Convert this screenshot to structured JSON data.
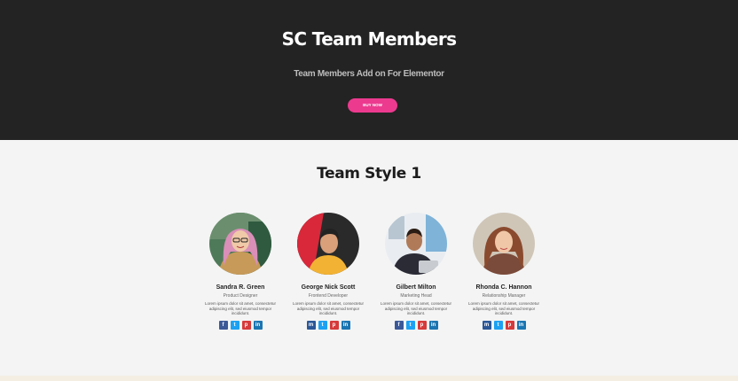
{
  "hero": {
    "title": "SC Team Members",
    "subtitle": "Team Members Add on For Elementor",
    "button_label": "Buy Now",
    "accent": "#ec3a8f",
    "background": "#232323"
  },
  "section": {
    "title": "Team Style 1"
  },
  "members": [
    {
      "name": "Sandra R. Green",
      "role": "Product Designer",
      "bio": "Lorem ipsum dolor sit amet, consectetur adipiscing elit, sed eiusmod tempor incididunt.",
      "socials": [
        "facebook-icon",
        "twitter-icon",
        "pinterest-icon",
        "linkedin-icon"
      ]
    },
    {
      "name": "George Nick Scott",
      "role": "Frontend Developer",
      "bio": "Lorem ipsum dolor sit amet, consectetur adipiscing elit, sed eiusmod tempor incididunt.",
      "socials": [
        "messenger-icon",
        "twitter-icon",
        "pinterest-icon",
        "linkedin-icon"
      ]
    },
    {
      "name": "Gilbert Milton",
      "role": "Marketing Head",
      "bio": "Lorem ipsum dolor sit amet, consectetur adipiscing elit, sed eiusmod tempor incididunt.",
      "socials": [
        "facebook-icon",
        "twitter-icon",
        "pinterest-icon",
        "linkedin-icon"
      ]
    },
    {
      "name": "Rhonda C. Hannon",
      "role": "Relationship Manager",
      "bio": "Lorem ipsum dolor sit amet, consectetur adipiscing elit, sed eiusmod tempor incididunt.",
      "socials": [
        "messenger-icon",
        "twitter-icon",
        "pinterest-icon",
        "linkedin-icon"
      ]
    }
  ]
}
